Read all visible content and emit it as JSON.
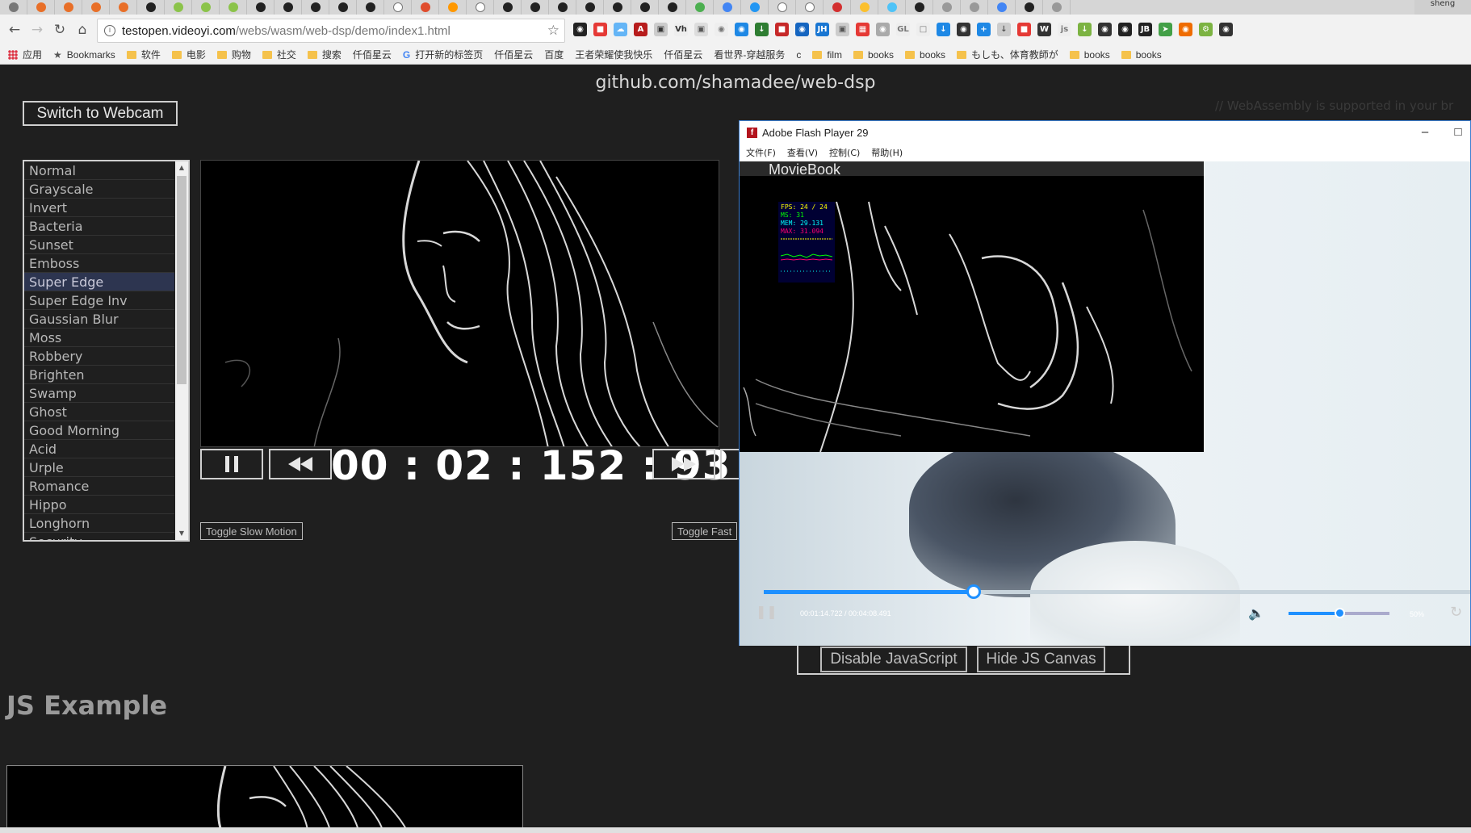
{
  "browser": {
    "url_host": "testopen.videoyi.com",
    "url_path": "/webs/wasm/web-dsp/demo/index1.html",
    "user_badge": "sheng",
    "bookmarks": [
      {
        "type": "apps",
        "label": "应用"
      },
      {
        "type": "star",
        "label": "Bookmarks"
      },
      {
        "type": "folder",
        "label": "软件"
      },
      {
        "type": "folder",
        "label": "电影"
      },
      {
        "type": "folder",
        "label": "购物"
      },
      {
        "type": "folder",
        "label": "社交"
      },
      {
        "type": "folder",
        "label": "搜索"
      },
      {
        "type": "page",
        "label": "仟佰星云"
      },
      {
        "type": "google",
        "label": "打开新的标签页"
      },
      {
        "type": "page",
        "label": "仟佰星云"
      },
      {
        "type": "page",
        "label": "百度"
      },
      {
        "type": "page",
        "label": "王者荣耀使我快乐"
      },
      {
        "type": "page",
        "label": "仟佰星云"
      },
      {
        "type": "page",
        "label": "看世界-穿越服务"
      },
      {
        "type": "page",
        "label": "c"
      },
      {
        "type": "folder",
        "label": "film"
      },
      {
        "type": "folder",
        "label": "books"
      },
      {
        "type": "folder",
        "label": "books"
      },
      {
        "type": "folder",
        "label": "もしも、体育教師が"
      },
      {
        "type": "folder",
        "label": "books"
      },
      {
        "type": "folder",
        "label": "books"
      }
    ]
  },
  "page": {
    "repo_link": "github.com/shamadee/web-dsp",
    "right_faint_text": "// WebAssembly is supported in your br",
    "webcam_button": "Switch to Webcam",
    "filters": [
      "Normal",
      "Grayscale",
      "Invert",
      "Bacteria",
      "Sunset",
      "Emboss",
      "Super Edge",
      "Super Edge Inv",
      "Gaussian Blur",
      "Moss",
      "Robbery",
      "Brighten",
      "Swamp",
      "Ghost",
      "Good Morning",
      "Acid",
      "Urple",
      "Romance",
      "Hippo",
      "Longhorn",
      "Security"
    ],
    "selected_filter": "Super Edge",
    "timecode": "00 : 02 : 152 : 93",
    "toggle_slow": "Toggle Slow Motion",
    "toggle_fast": "Toggle Fast",
    "disable_js": "Disable JavaScript",
    "hide_js_canvas": "Hide JS Canvas",
    "js_example_title": "JS Example"
  },
  "flash": {
    "title": "Adobe Flash Player 29",
    "menu": [
      "文件(F)",
      "查看(V)",
      "控制(C)",
      "帮助(H)"
    ],
    "moviebook_label": "MovieBook",
    "stats": {
      "fps": "FPS: 24 / 24",
      "ms": "MS: 31",
      "mem": "MEM: 29.131",
      "max": "MAX: 31.094"
    },
    "time_display": "00:01:14.722 / 00:04:08.491",
    "seek_progress": 0.3,
    "volume_label": "50%",
    "volume_level": 0.5
  },
  "colors": {
    "background": "#1f1f1f",
    "selected_filter_bg": "#2d3550",
    "flash_accent": "#1e90ff"
  }
}
